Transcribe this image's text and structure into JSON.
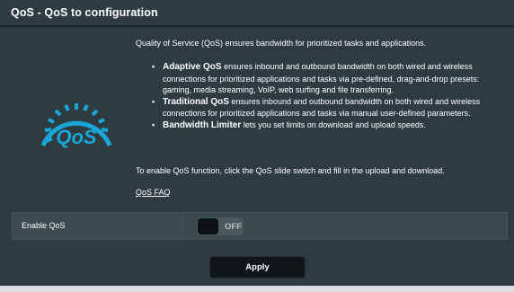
{
  "page": {
    "title": "QoS - QoS to configuration"
  },
  "logo": {
    "icon": "qos-speedometer-icon",
    "text": "QoS",
    "color": "#1aa7d8"
  },
  "description": {
    "intro": "Quality of Service (QoS) ensures bandwidth for prioritized tasks and applications.",
    "items": [
      {
        "title": "Adaptive QoS",
        "text": " ensures inbound and outbound bandwidth on both wired and wireless connections for prioritized applications and tasks via pre-defined, drag-and-drop presets: gaming, media streaming, VoIP, web surfing and file transferring."
      },
      {
        "title": "Traditional QoS",
        "text": " ensures inbound and outbound bandwidth on both wired and wireless connections for prioritized applications and tasks via manual user-defined parameters."
      },
      {
        "title": "Bandwidth Limiter",
        "text": " lets you set limits on download and upload speeds."
      }
    ],
    "enable_note": "To enable QoS function, click the QoS slide switch and fill in the upload and download.",
    "faq_link": "QoS FAQ"
  },
  "settings": {
    "enable_qos_label": "Enable QoS",
    "toggle_state": "OFF"
  },
  "actions": {
    "apply_label": "Apply"
  },
  "colors": {
    "panel_bg": "#2e3b40",
    "accent": "#1aa7d8",
    "button_bg": "#101518"
  }
}
